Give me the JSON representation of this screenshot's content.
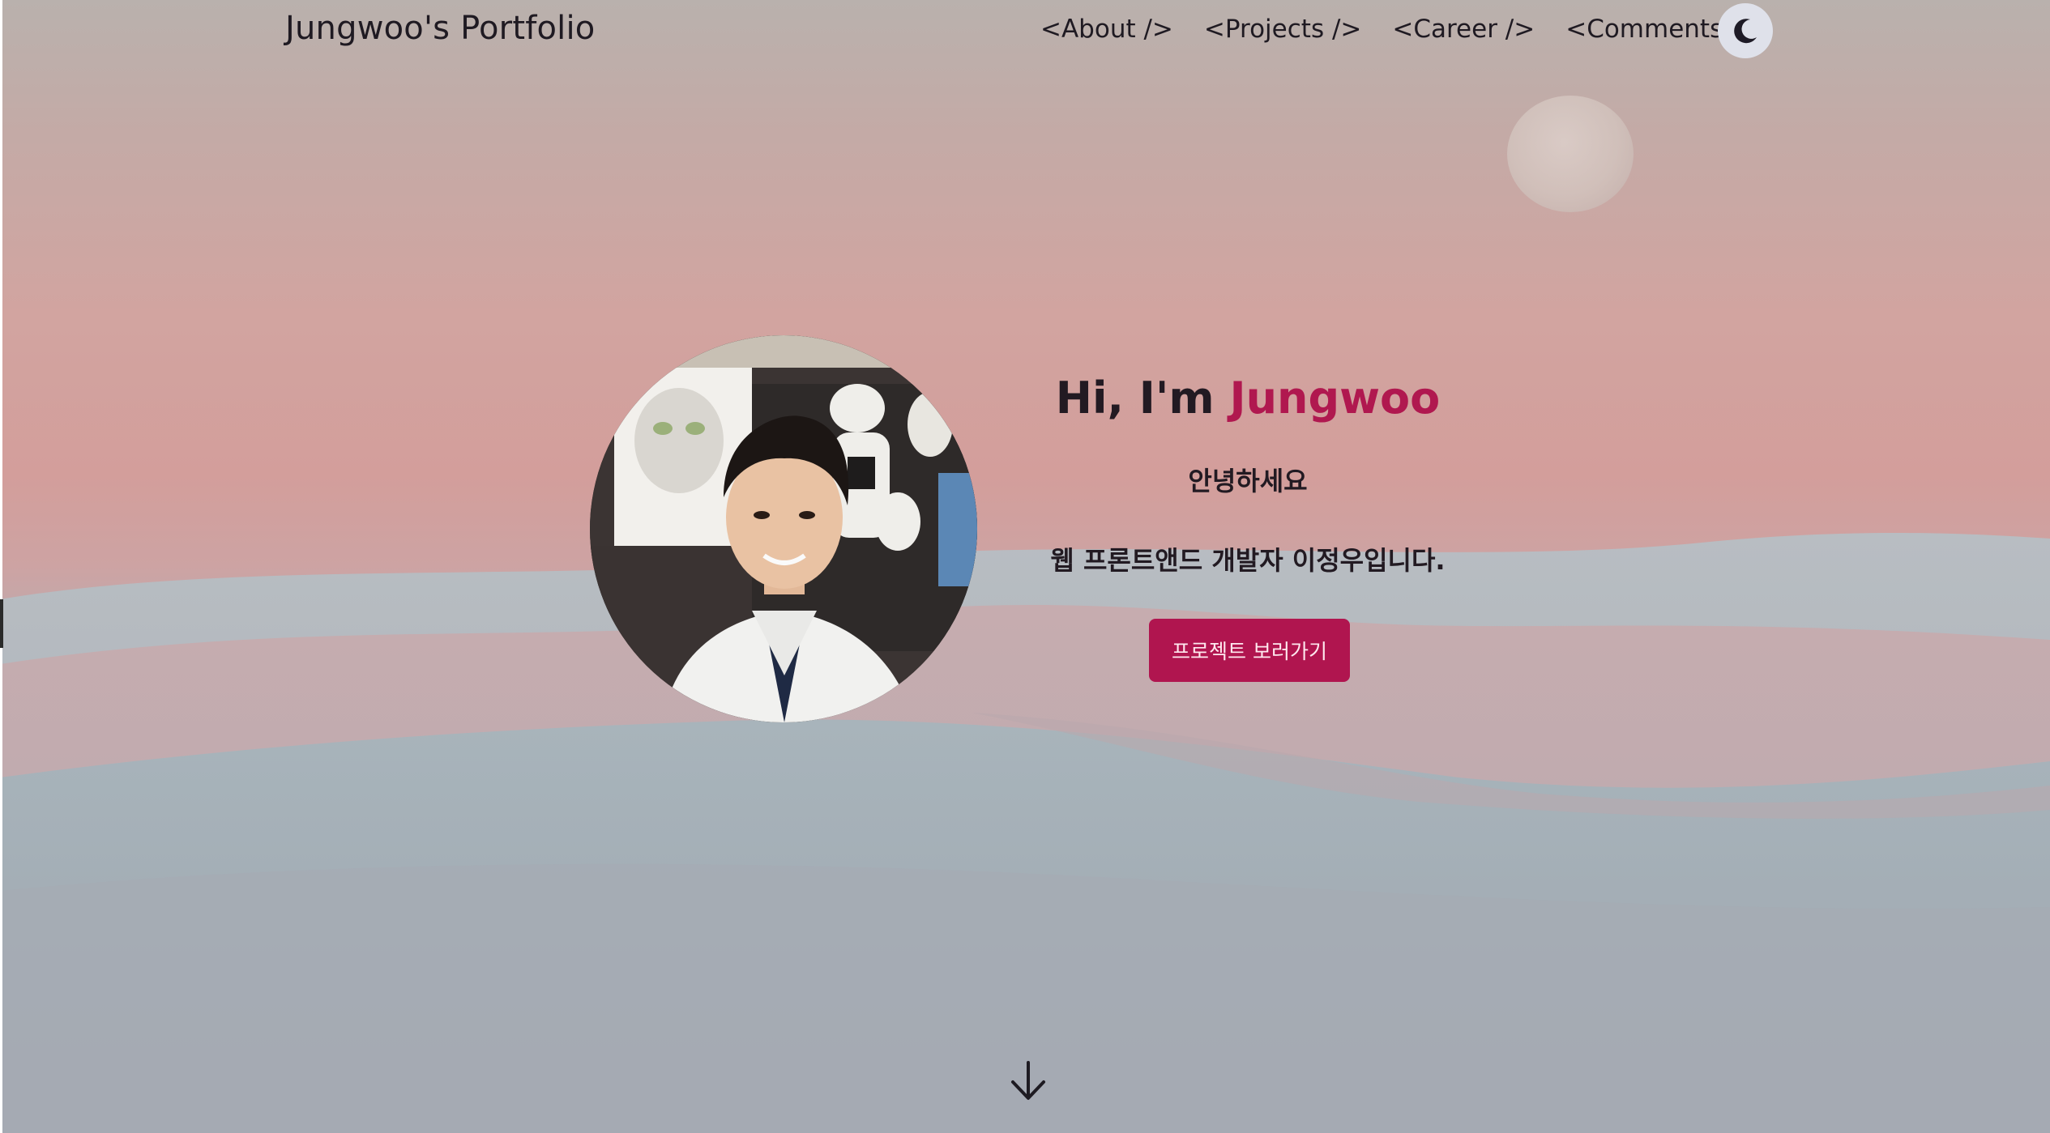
{
  "header": {
    "brand": "Jungwoo's Portfolio",
    "nav": [
      {
        "label": "<About />"
      },
      {
        "label": "<Projects />"
      },
      {
        "label": "<Career />"
      },
      {
        "label": "<Comments />"
      }
    ],
    "theme_toggle_icon": "moon-icon"
  },
  "hero": {
    "title_prefix": "Hi, I'm ",
    "title_name": "Jungwoo",
    "greeting": "안녕하세요",
    "intro": "웹 프론트앤드 개발자 이정우입니다.",
    "cta_label": "프로젝트 보러가기",
    "scroll_icon": "arrow-down-icon"
  },
  "colors": {
    "accent": "#b0184f",
    "text": "#221a22",
    "toggle_bg": "#dfe1ea"
  }
}
